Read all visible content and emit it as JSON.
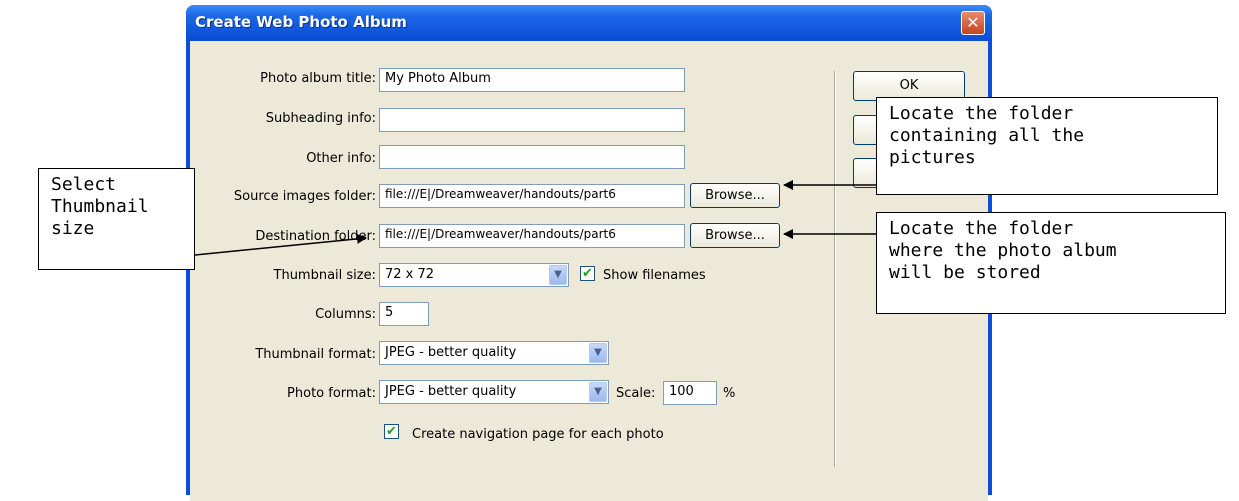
{
  "dialog": {
    "title": "Create Web Photo Album",
    "close_glyph": "✕"
  },
  "form": {
    "photo_album_title_label": "Photo album title:",
    "photo_album_title_value": "My Photo Album",
    "subheading_label": "Subheading info:",
    "subheading_value": "",
    "other_info_label": "Other info:",
    "other_info_value": "",
    "source_folder_label": "Source images folder:",
    "source_folder_value": "file:///E|/Dreamweaver/handouts/part6",
    "destination_folder_label": "Destination folder:",
    "destination_folder_value": "file:///E|/Dreamweaver/handouts/part6",
    "browse_label": "Browse...",
    "thumbnail_size_label": "Thumbnail size:",
    "thumbnail_size_value": "72 x 72",
    "show_filenames_label": "Show filenames",
    "show_filenames_checked": true,
    "columns_label": "Columns:",
    "columns_value": "5",
    "thumbnail_format_label": "Thumbnail format:",
    "thumbnail_format_value": "JPEG - better quality",
    "photo_format_label": "Photo format:",
    "photo_format_value": "JPEG - better quality",
    "scale_label": "Scale:",
    "scale_value": "100",
    "scale_unit": "%",
    "create_nav_label": "Create navigation page for each photo",
    "create_nav_checked": true
  },
  "buttons": {
    "ok_label": "OK"
  },
  "callouts": {
    "select_thumbnail": "Select\nThumbnail\nsize",
    "locate_source": "Locate the folder\ncontaining all the\npictures",
    "locate_destination": "Locate the folder\nwhere the photo album\nwill be stored"
  },
  "icons": {
    "checkmark": "✔",
    "dropdown_arrow": "▼"
  },
  "colors": {
    "titlebar": "#0a4dd6",
    "dialog_face": "#ece9d8",
    "close_button": "#c7441e"
  }
}
